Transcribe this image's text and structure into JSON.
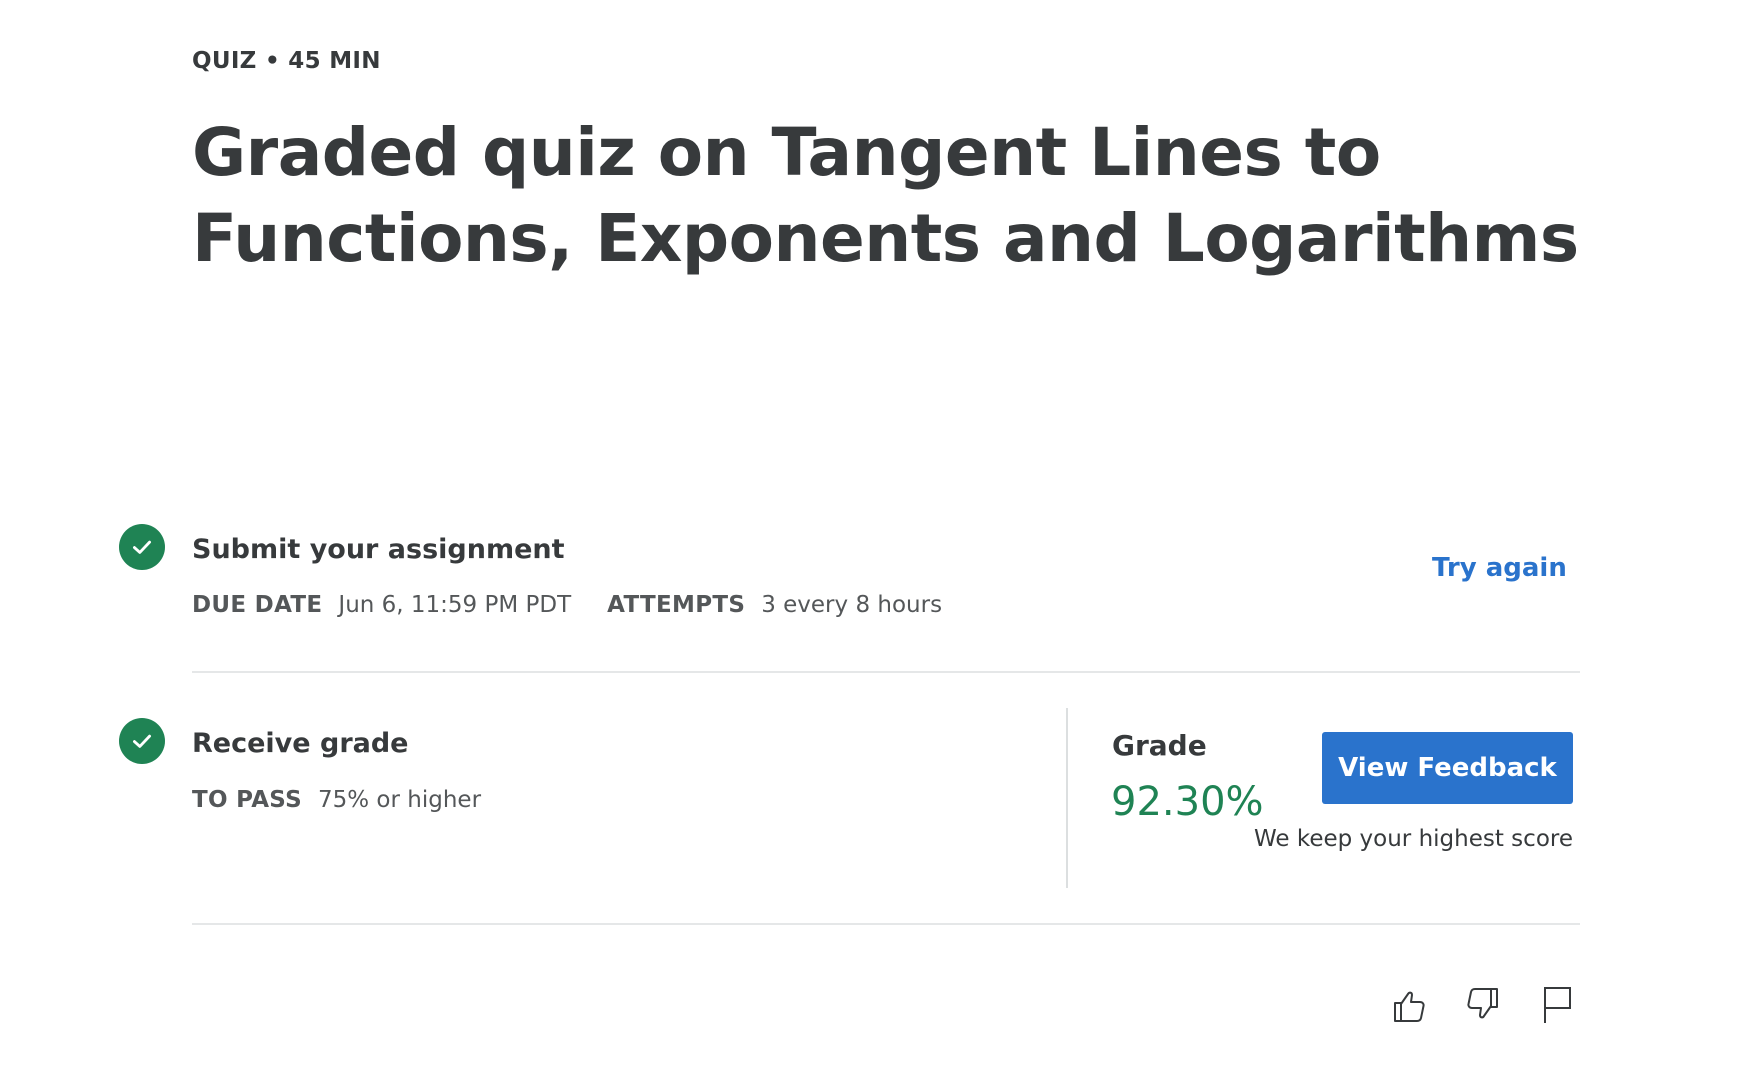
{
  "header": {
    "eyebrow": "QUIZ • 45 MIN",
    "title": "Graded quiz on Tangent Lines to Functions, Exponents and Logarithms"
  },
  "submit_step": {
    "title": "Submit your assignment",
    "due_label": "DUE DATE",
    "due_value": "Jun 6, 11:59 PM PDT",
    "attempts_label": "ATTEMPTS",
    "attempts_value": "3 every 8 hours",
    "action_label": "Try again"
  },
  "grade_step": {
    "title": "Receive grade",
    "pass_label": "TO PASS",
    "pass_value": "75% or higher",
    "grade_label": "Grade",
    "grade_value": "92.30%",
    "button_label": "View Feedback",
    "hint": "We keep your highest score"
  },
  "footer": {
    "icons": [
      "thumbs-up-icon",
      "thumbs-down-icon",
      "flag-icon"
    ]
  },
  "colors": {
    "success": "#1f8354",
    "primary": "#2a73cc",
    "text": "#373a3c"
  }
}
